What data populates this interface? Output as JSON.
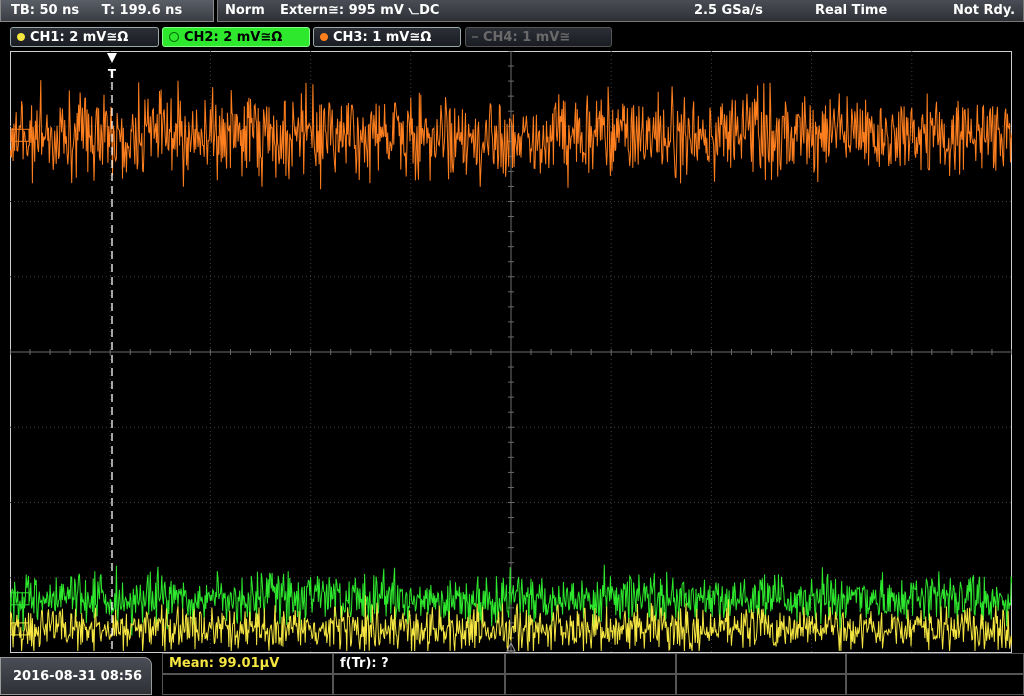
{
  "topbar": {
    "timebase": "TB: 50 ns",
    "trigger_time": "T: 199.6 ns",
    "mode": "Norm",
    "trigger_source": "Extern≅: 995 mV ⦦DC",
    "sample_rate": "2.5 GSa/s",
    "acquisition": "Real Time",
    "status": "Not Rdy."
  },
  "channels": [
    {
      "label": "CH1: 2 mV≅Ω",
      "color": "#f5e642",
      "active": true
    },
    {
      "label": "CH2: 2 mV≅Ω",
      "color": "#2ee82e",
      "active": true,
      "selected": true
    },
    {
      "label": "CH3: 1 mV≅Ω",
      "color": "#ff7f1f",
      "active": true
    },
    {
      "label": "CH4: 1 mV≅",
      "color": "#777777",
      "active": false
    }
  ],
  "screen": {
    "trigger_marker": "T",
    "traces": [
      {
        "channel": "CH3",
        "color": "#ff7f1f",
        "level": 0.86,
        "noise": 0.075
      },
      {
        "channel": "CH2",
        "color": "#2ee82e",
        "level": 0.09,
        "noise": 0.045
      },
      {
        "channel": "CH1",
        "color": "#f5e642",
        "level": 0.04,
        "noise": 0.04
      }
    ],
    "ref_markers": [
      "CH3",
      "CH2",
      "CH1"
    ]
  },
  "bottom": {
    "datetime": "2016-08-31 08:56",
    "measurements": [
      {
        "label": "Mean: 99.01µV",
        "color": "#f5e642"
      },
      {
        "label": "f(Tr): ?",
        "color": "#ffffff"
      }
    ]
  }
}
